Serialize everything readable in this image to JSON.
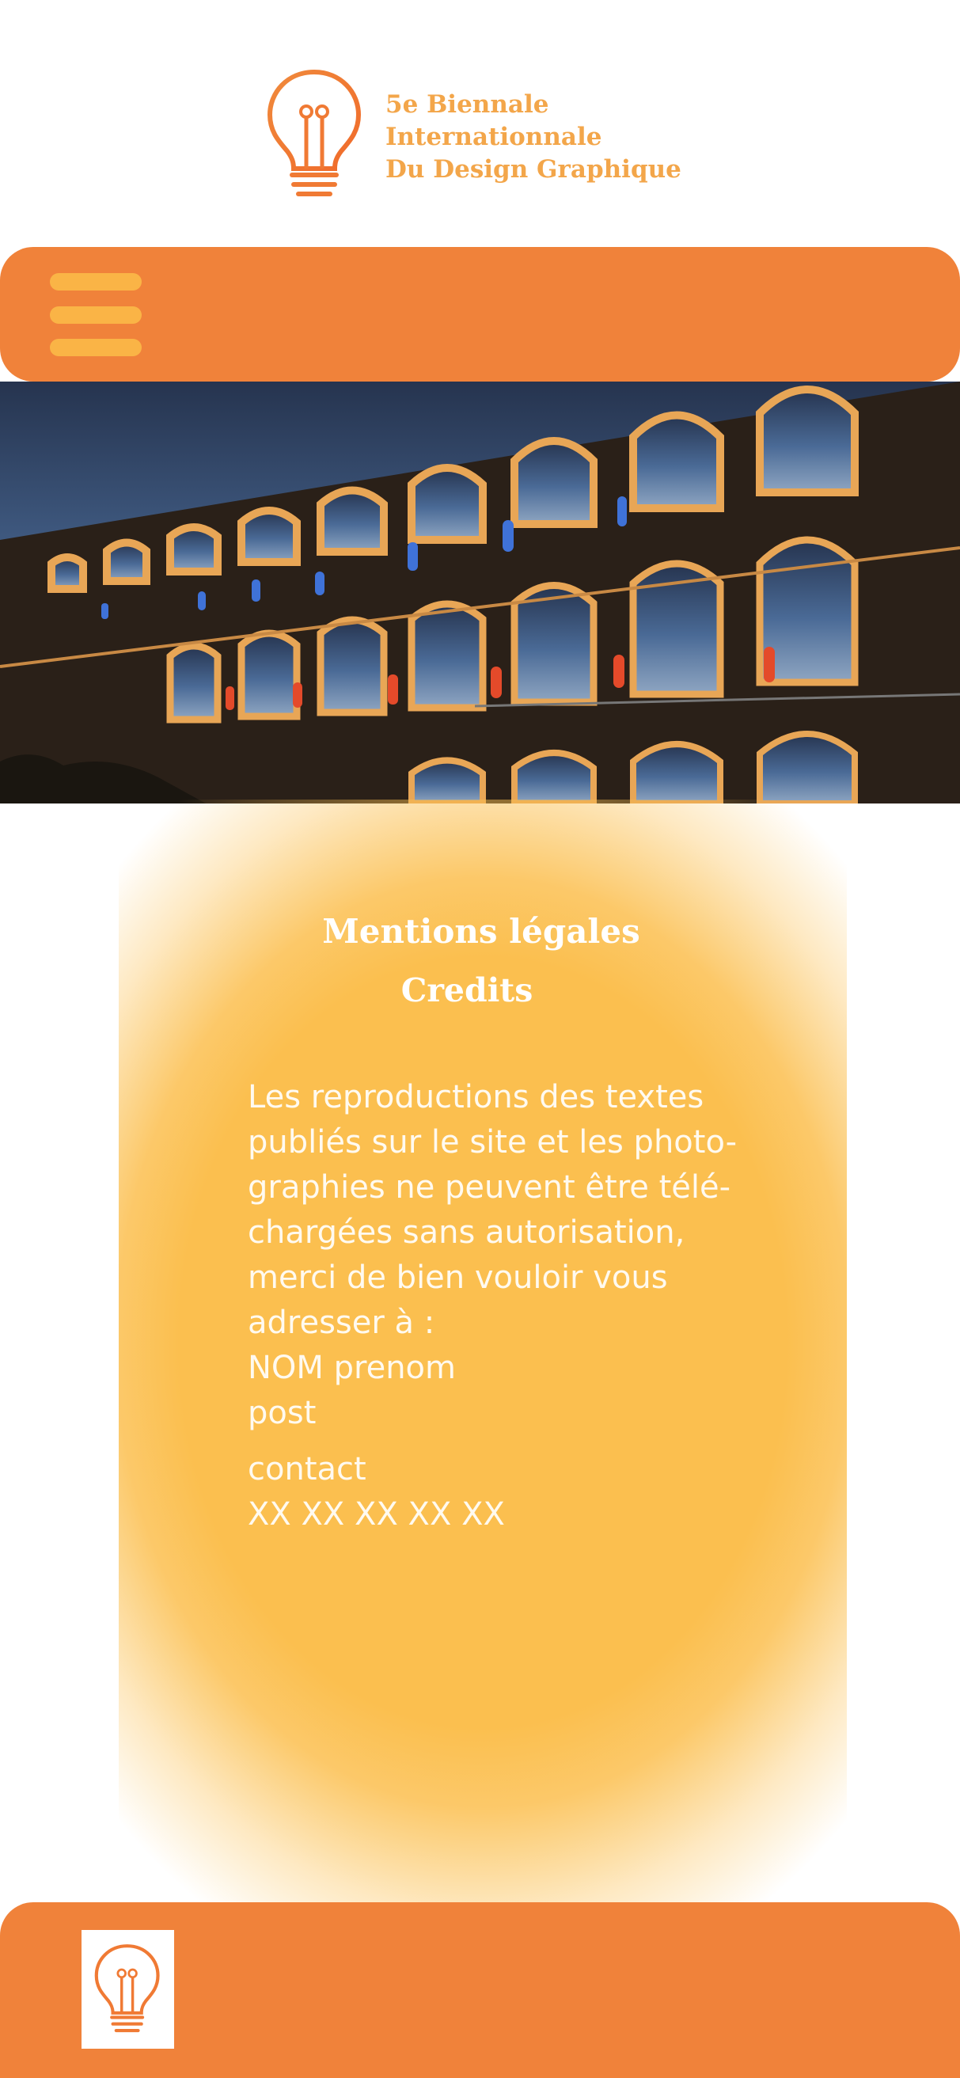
{
  "header": {
    "logo_icon": "lightbulb-icon",
    "logo_lines": [
      "5e Biennale",
      "Internationnale",
      "Du Design Graphique"
    ]
  },
  "navbar": {
    "menu_icon": "hamburger-menu-icon"
  },
  "hero": {
    "image": "illuminated-viaduct-photo"
  },
  "content": {
    "title": "Mentions légales",
    "subtitle": "Credits",
    "body_lines": [
      "Les reproductions des textes",
      "publiés sur le site et les photo-",
      "graphies ne peuvent être télé-",
      "chargées sans autorisation,",
      "merci de bien vouloir vous",
      "adresser à :",
      "NOM prenom",
      "post"
    ],
    "contact_lines": [
      "contact",
      "XX XX XX XX XX"
    ]
  },
  "footer": {
    "logo_icon": "lightbulb-icon"
  },
  "colors": {
    "brand_orange": "#f0823a",
    "accent_yellow": "#fbbf4f",
    "logo_text": "#f3a64a"
  }
}
